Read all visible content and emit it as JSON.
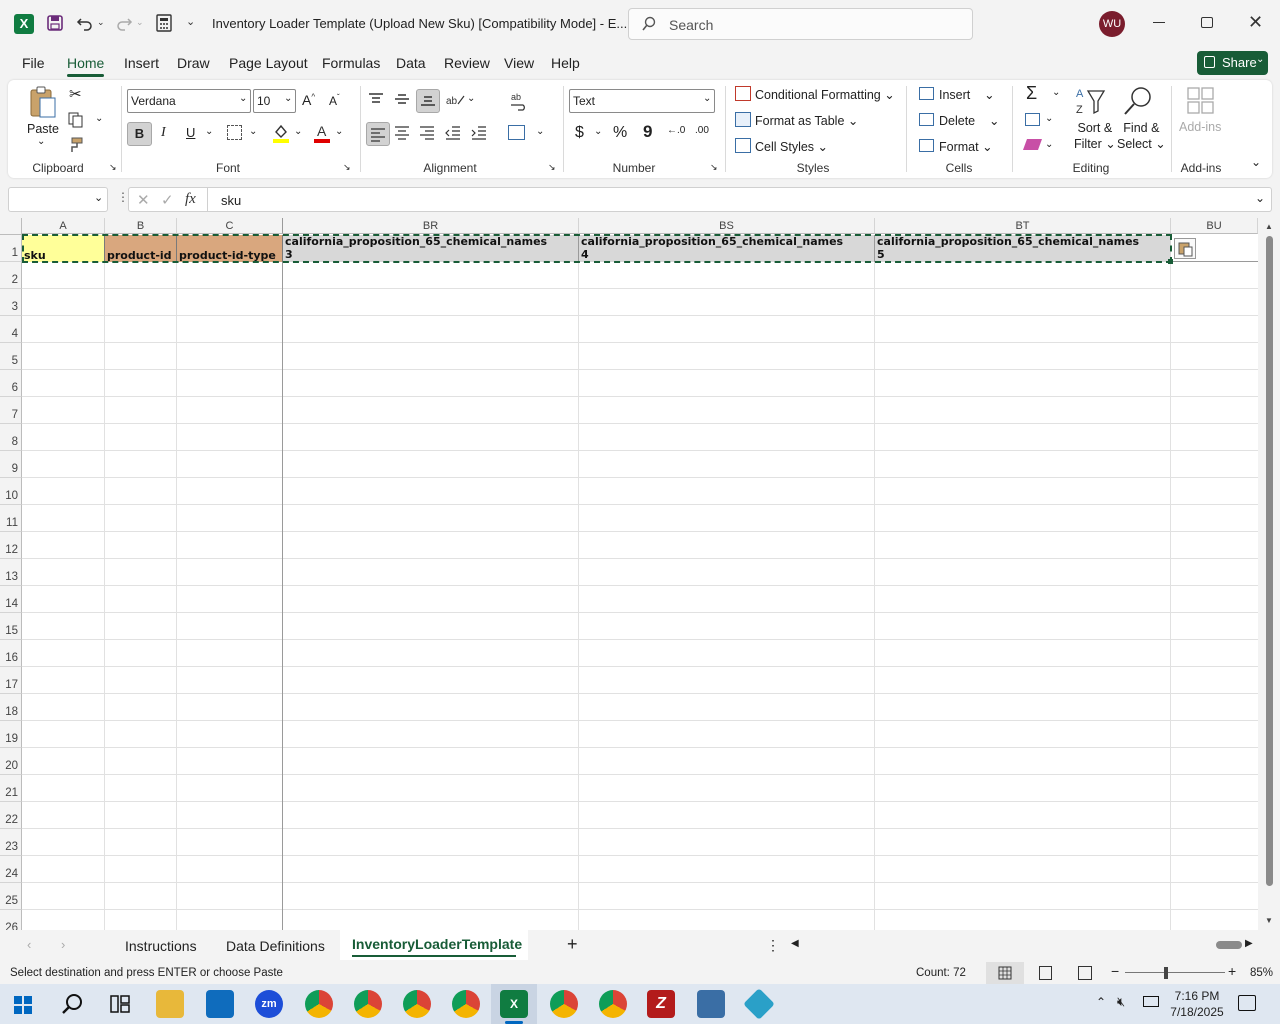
{
  "window": {
    "title": "Inventory Loader Template (Upload New Sku)  [Compatibility Mode]  -  E...",
    "search_placeholder": "Search",
    "user_initials": "WU",
    "share_label": "Share"
  },
  "menu_tabs": [
    "File",
    "Home",
    "Insert",
    "Draw",
    "Page Layout",
    "Formulas",
    "Data",
    "Review",
    "View",
    "Help"
  ],
  "ribbon": {
    "clipboard": {
      "paste": "Paste",
      "group": "Clipboard"
    },
    "font": {
      "name": "Verdana",
      "size": "10",
      "bold": "B",
      "italic": "I",
      "underline": "U",
      "group": "Font"
    },
    "alignment": {
      "group": "Alignment"
    },
    "number": {
      "format": "Text",
      "group": "Number",
      "currency": "$",
      "percent": "%",
      "comma": "9"
    },
    "styles": {
      "conditional": "Conditional Formatting",
      "format_table": "Format as Table",
      "cell_styles": "Cell Styles",
      "group": "Styles"
    },
    "cells": {
      "insert": "Insert",
      "delete": "Delete",
      "format": "Format",
      "group": "Cells"
    },
    "editing": {
      "sort_line1": "Sort &",
      "sort_line2": "Filter",
      "find_line1": "Find &",
      "find_line2": "Select",
      "group": "Editing"
    },
    "addins": {
      "label": "Add-ins",
      "group": "Add-ins"
    }
  },
  "formula_bar": {
    "name_box": "",
    "fx": "fx",
    "content": "sku"
  },
  "grid": {
    "columns": [
      "A",
      "B",
      "C",
      "BR",
      "BS",
      "BT",
      "BU"
    ],
    "rows": [
      "1",
      "2",
      "3",
      "4",
      "5",
      "6",
      "7",
      "8",
      "9",
      "10",
      "11",
      "12",
      "13",
      "14",
      "15",
      "16",
      "17",
      "18",
      "19",
      "20",
      "21",
      "22",
      "23",
      "24",
      "25",
      "26"
    ],
    "row1": {
      "A": "sku",
      "B": "product-id",
      "C": "product-id-type",
      "BR_line1": "california_proposition_65_chemical_names",
      "BR_line2": "3",
      "BS_line1": "california_proposition_65_chemical_names",
      "BS_line2": "4",
      "BT_line1": "california_proposition_65_chemical_names",
      "BT_line2": "5"
    }
  },
  "sheets": [
    "Instructions",
    "Data Definitions",
    "InventoryLoaderTemplate"
  ],
  "active_sheet": "InventoryLoaderTemplate",
  "status": {
    "message": "Select destination and press ENTER or choose Paste",
    "count": "Count: 72",
    "zoom": "85%"
  },
  "taskbar": {
    "time": "7:16 PM",
    "date": "7/18/2025"
  },
  "colors": {
    "accent": "#185c37",
    "cell_yellow": "#ffff99",
    "cell_tan": "#d9a77e",
    "cell_selected": "#d8d8d8"
  }
}
